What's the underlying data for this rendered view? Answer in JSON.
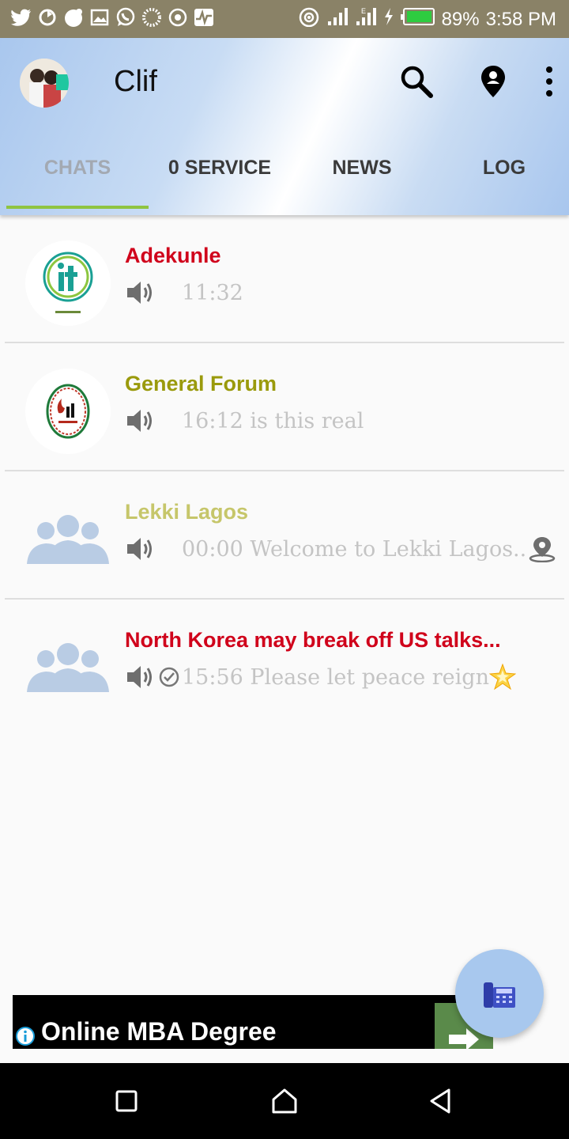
{
  "status_bar": {
    "battery": "89%",
    "time": "3:58 PM",
    "icons": [
      "twitter-icon",
      "sync-icon",
      "gecko-icon",
      "image-icon",
      "whatsapp-icon",
      "loading-icon",
      "target-icon",
      "activity-icon",
      "hotspot-icon",
      "signal-icon",
      "signal-e-icon",
      "charging-icon",
      "battery-icon"
    ]
  },
  "header": {
    "title": "Clif",
    "actions": [
      "search-icon",
      "location-pin-icon",
      "more-vertical-icon"
    ]
  },
  "tabs": [
    {
      "label": "CHATS",
      "active": true
    },
    {
      "label": "0 SERVICE",
      "active": false
    },
    {
      "label": "NEWS",
      "active": false
    },
    {
      "label": "LOG",
      "active": false
    }
  ],
  "chats": [
    {
      "name": "Adekunle",
      "name_color": "#d0021b",
      "message": "11:32",
      "avatar": "it-logo",
      "has_check": false,
      "trailing": ""
    },
    {
      "name": "General Forum",
      "name_color": "#9a9a0c",
      "message": "16:12 is this real",
      "avatar": "oil-logo",
      "has_check": false,
      "trailing": ""
    },
    {
      "name": "Lekki Lagos",
      "name_color": "#c6c66a",
      "message": "00:00 Welcome to Lekki Lagos..",
      "avatar": "group-icon",
      "has_check": false,
      "trailing": "location-icon"
    },
    {
      "name": "North Korea may break off US talks...",
      "name_color": "#d0021b",
      "message": "15:56 Please let peace reign",
      "avatar": "group-icon",
      "has_check": true,
      "trailing": "star-emoji"
    }
  ],
  "ad": {
    "text": "Online MBA Degree"
  },
  "fab": {
    "icon": "phone-icon"
  },
  "nav": [
    "recent-apps-icon",
    "home-icon",
    "back-icon"
  ],
  "colors": {
    "status_bar": "#8a8267",
    "tab_indicator": "#8fc441",
    "fab": "#a8c8ee",
    "group_icon": "#b9cce4"
  }
}
